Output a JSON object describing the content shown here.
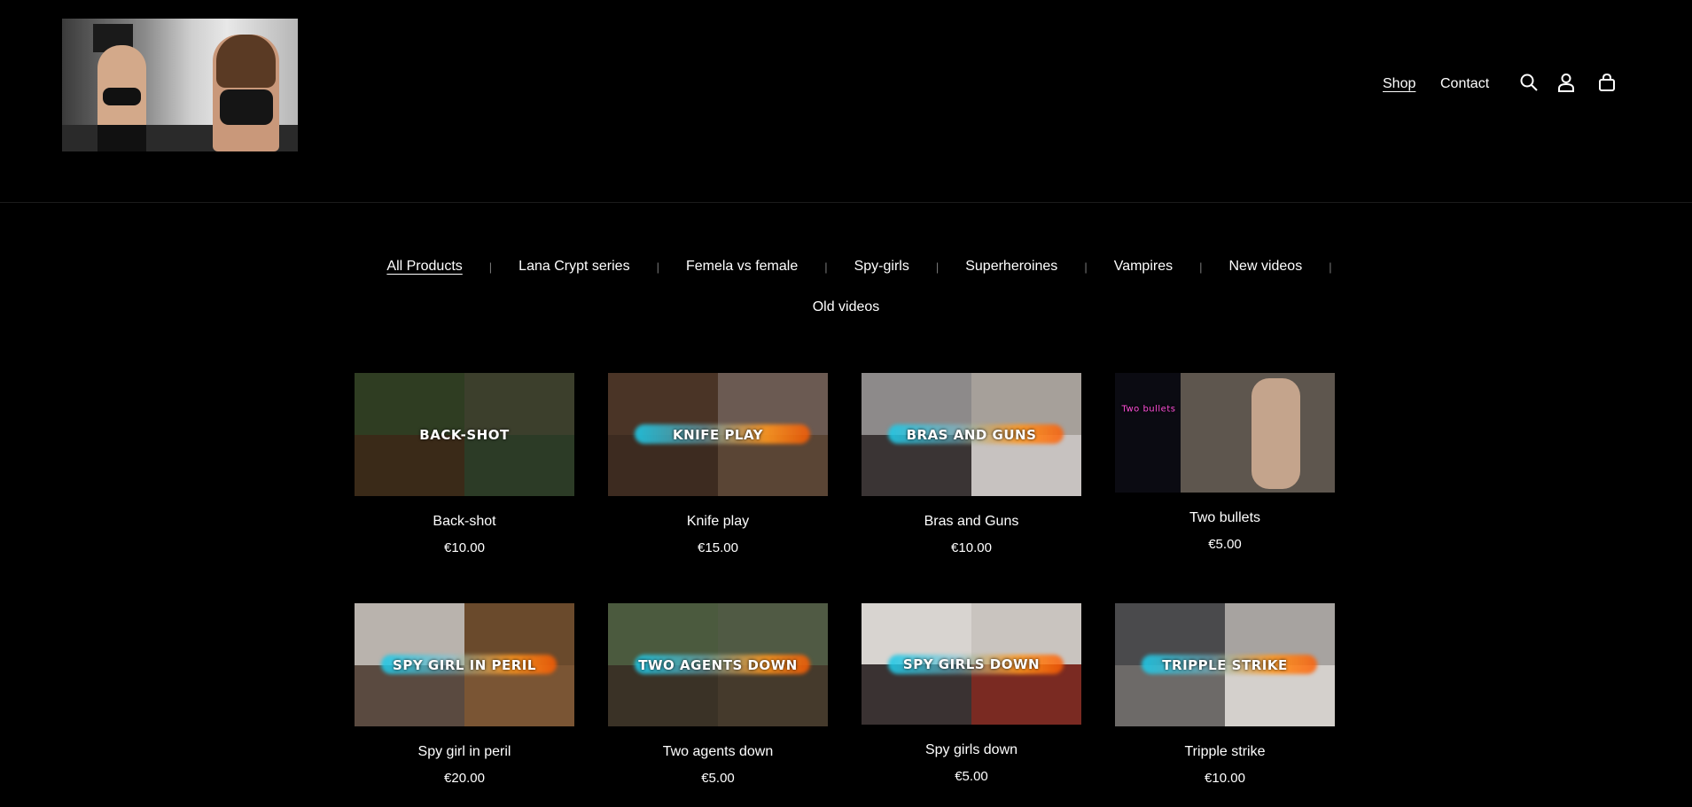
{
  "header": {
    "nav": {
      "shop": "Shop",
      "contact": "Contact"
    }
  },
  "categories": {
    "row1": [
      "All Products",
      "Lana Crypt series",
      "Femela vs female",
      "Spy-girls",
      "Superheroines",
      "Vampires",
      "New videos"
    ],
    "row2": "Old videos"
  },
  "products": [
    {
      "name": "Back-shot",
      "price": "€10.00",
      "thumb_text": "BACK-SHOT"
    },
    {
      "name": "Knife play",
      "price": "€15.00",
      "thumb_text": "KNIFE PLAY"
    },
    {
      "name": "Bras and Guns",
      "price": "€10.00",
      "thumb_text": "BRAS AND GUNS"
    },
    {
      "name": "Two bullets",
      "price": "€5.00",
      "thumb_text": "Two bullets"
    },
    {
      "name": "Spy girl in peril",
      "price": "€20.00",
      "thumb_text": "SPY GIRL IN PERIL"
    },
    {
      "name": "Two agents down",
      "price": "€5.00",
      "thumb_text": "TWO AGENTS DOWN"
    },
    {
      "name": "Spy girls down",
      "price": "€5.00",
      "thumb_text": "SPY GIRLS DOWN"
    },
    {
      "name": "Tripple strike",
      "price": "€10.00",
      "thumb_text": "TRIPPLE STRIKE"
    }
  ],
  "icons": {
    "search": "search-icon",
    "account": "user-icon",
    "cart": "bag-icon"
  }
}
